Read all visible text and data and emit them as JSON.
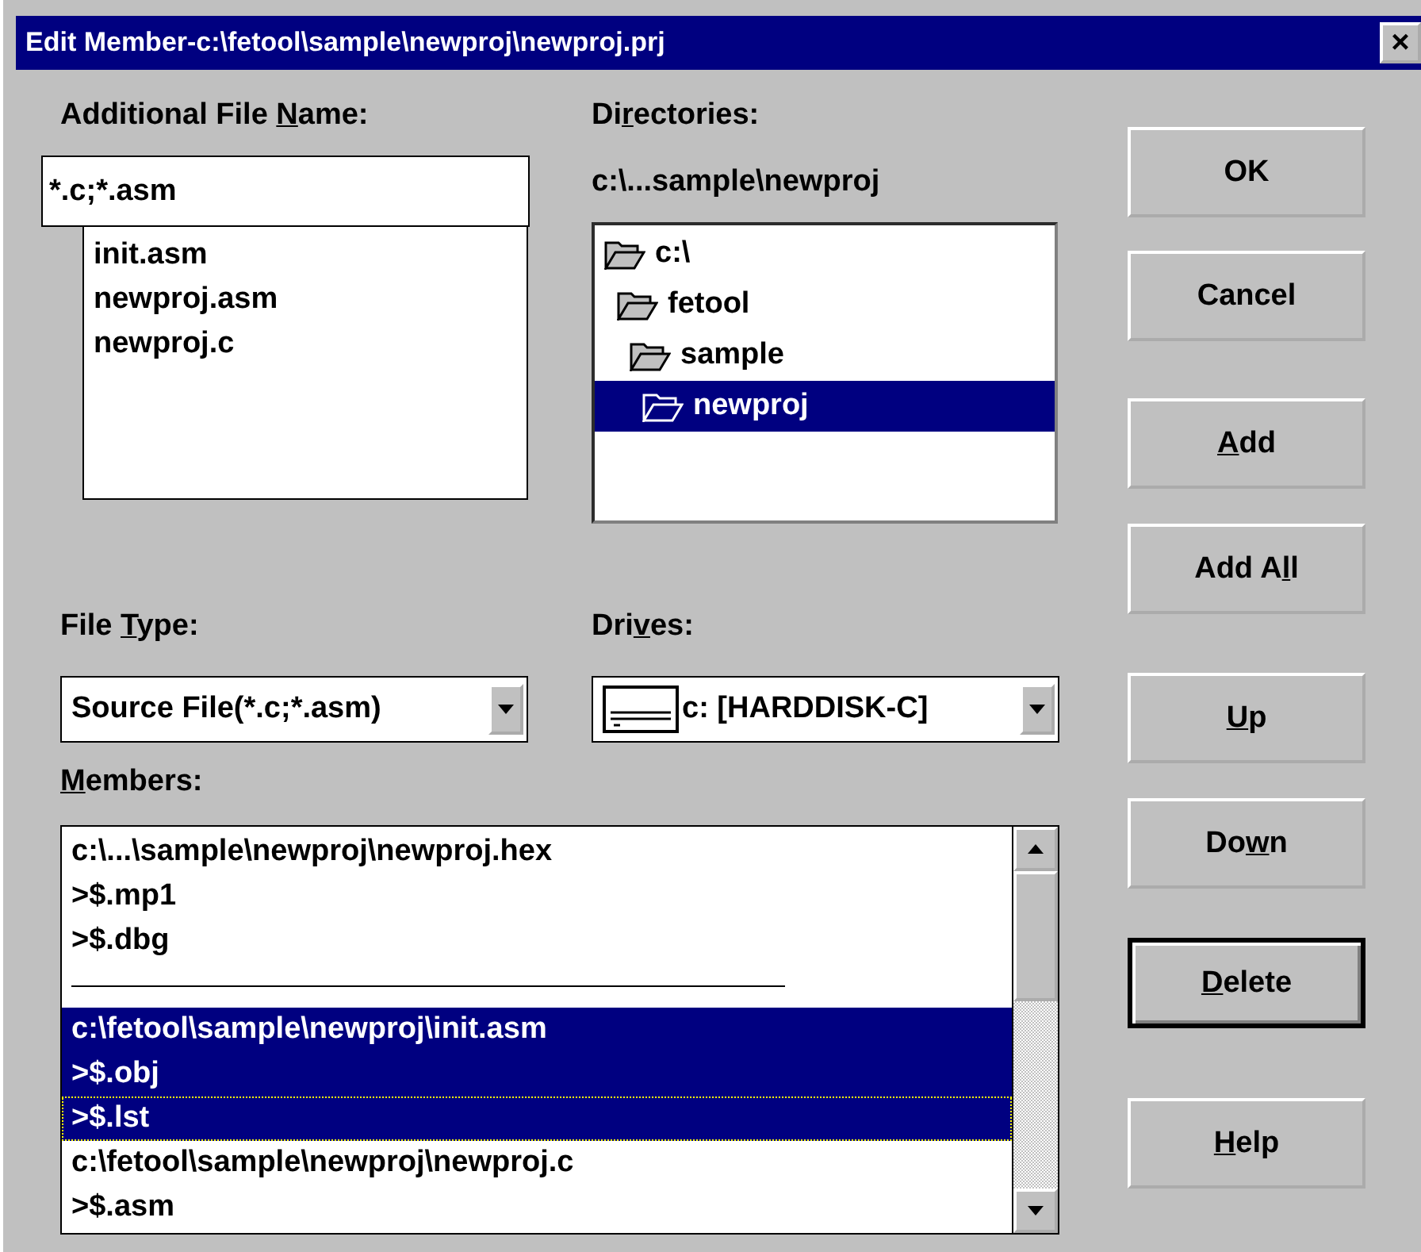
{
  "window": {
    "title": "Edit Member-c:\\fetool\\sample\\newproj\\newproj.prj",
    "close": "×"
  },
  "file_name": {
    "label": {
      "before": "Additional File ",
      "key": "N",
      "after": "ame:"
    },
    "value": "*.c;*.asm",
    "files": [
      {
        "name": "init.asm"
      },
      {
        "name": "newproj.asm"
      },
      {
        "name": "newproj.c"
      }
    ]
  },
  "directories": {
    "label": {
      "before": "Di",
      "key": "r",
      "after": "ectories:"
    },
    "path": "c:\\...sample\\newproj",
    "tree": [
      {
        "name": "c:\\",
        "selected": false,
        "children": [
          {
            "name": "fetool",
            "selected": false,
            "children": [
              {
                "name": "sample",
                "selected": false,
                "children": [
                  {
                    "name": "newproj",
                    "selected": true
                  }
                ]
              }
            ]
          }
        ]
      }
    ]
  },
  "file_type": {
    "label": {
      "before": "File ",
      "key": "T",
      "after": "ype:"
    },
    "value": "Source File(*.c;*.asm)"
  },
  "drives": {
    "label": {
      "before": "Dri",
      "key": "v",
      "after": "es:"
    },
    "value": "c: [HARDDISK-C]"
  },
  "members": {
    "label": {
      "key": "M",
      "after": "embers:"
    },
    "items": [
      {
        "kind": "item",
        "text": "c:\\...\\sample\\newproj\\newproj.hex",
        "selected": false,
        "focused": false
      },
      {
        "kind": "item",
        "text": ">$.mp1",
        "selected": false,
        "focused": false
      },
      {
        "kind": "item",
        "text": ">$.dbg",
        "selected": false,
        "focused": false
      },
      {
        "kind": "separator"
      },
      {
        "kind": "item",
        "text": "c:\\fetool\\sample\\newproj\\init.asm",
        "selected": true,
        "focused": false
      },
      {
        "kind": "item",
        "text": ">$.obj",
        "selected": true,
        "focused": false
      },
      {
        "kind": "item",
        "text": ">$.lst",
        "selected": true,
        "focused": true
      },
      {
        "kind": "item",
        "text": "c:\\fetool\\sample\\newproj\\newproj.c",
        "selected": false,
        "focused": false
      },
      {
        "kind": "item",
        "text": ">$.asm",
        "selected": false,
        "focused": false
      }
    ]
  },
  "buttons": [
    {
      "label": {
        "before": "OK"
      },
      "default": false
    },
    {
      "label": {
        "before": "Cancel"
      },
      "default": false
    },
    {
      "label": {
        "key": "A",
        "after": "dd"
      },
      "default": false
    },
    {
      "label": {
        "before": "Add A",
        "key": "l",
        "after": "l"
      },
      "default": false
    },
    {
      "label": {
        "key": "U",
        "after": "p"
      },
      "default": false
    },
    {
      "label": {
        "before": "Do",
        "key": "w",
        "after": "n"
      },
      "default": false
    },
    {
      "label": {
        "key": "D",
        "after": "elete"
      },
      "default": true
    },
    {
      "label": {
        "key": "H",
        "after": "elp"
      },
      "default": false
    }
  ]
}
